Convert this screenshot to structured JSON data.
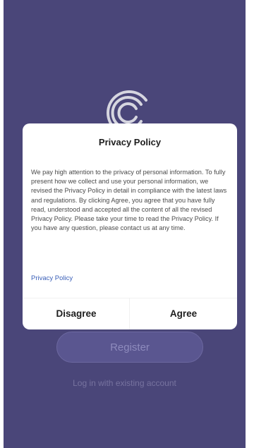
{
  "colors": {
    "background": "#4a4679",
    "dialog": "#ffffff",
    "link": "#3a5fb8"
  },
  "logo": {
    "icon": "signal-arc-logo-icon"
  },
  "register_button": {
    "label": "Register"
  },
  "login_link": {
    "label": "Log in with existing account"
  },
  "privacy_dialog": {
    "title": "Privacy Policy",
    "body": "We pay high attention to the privacy of personal information. To fully present how we collect and use your personal information, we revised the Privacy Policy in detail in compliance with the latest laws and regulations. By clicking Agree, you agree that you have fully read, understood and accepted all the content of all the revised Privacy Policy. Please take your time to read the Privacy Policy. If you have any question, please contact us at any time.",
    "policy_link": "Privacy Policy",
    "disagree_label": "Disagree",
    "agree_label": "Agree"
  }
}
